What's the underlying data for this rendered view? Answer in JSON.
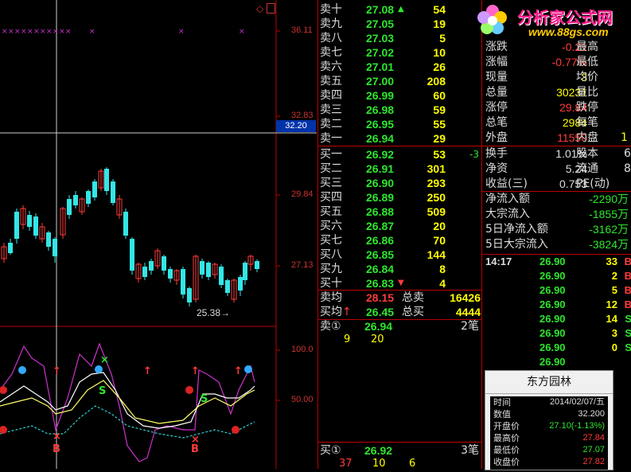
{
  "chart_axis": {
    "p1": "36.11",
    "p2": "32.83",
    "p3": "29.84",
    "p4": "27.13",
    "cursor": "32.20",
    "i1": "100.0",
    "i2": "50.00"
  },
  "annotation": "25.38",
  "sell_rows": [
    {
      "label": "卖十",
      "price": "27.08",
      "vol": "54",
      "arrow": "up"
    },
    {
      "label": "卖九",
      "price": "27.05",
      "vol": "19"
    },
    {
      "label": "卖八",
      "price": "27.03",
      "vol": "5"
    },
    {
      "label": "卖七",
      "price": "27.02",
      "vol": "10"
    },
    {
      "label": "卖六",
      "price": "27.01",
      "vol": "26"
    },
    {
      "label": "卖五",
      "price": "27.00",
      "vol": "208"
    },
    {
      "label": "卖四",
      "price": "26.99",
      "vol": "60"
    },
    {
      "label": "卖三",
      "price": "26.98",
      "vol": "59"
    },
    {
      "label": "卖二",
      "price": "26.95",
      "vol": "55"
    },
    {
      "label": "卖一",
      "price": "26.94",
      "vol": "29"
    }
  ],
  "buy_rows": [
    {
      "label": "买一",
      "price": "26.92",
      "vol": "53",
      "extra": "-3"
    },
    {
      "label": "买二",
      "price": "26.91",
      "vol": "301"
    },
    {
      "label": "买三",
      "price": "26.90",
      "vol": "293"
    },
    {
      "label": "买四",
      "price": "26.89",
      "vol": "250"
    },
    {
      "label": "买五",
      "price": "26.88",
      "vol": "509"
    },
    {
      "label": "买六",
      "price": "26.87",
      "vol": "20"
    },
    {
      "label": "买七",
      "price": "26.86",
      "vol": "70"
    },
    {
      "label": "买八",
      "price": "26.85",
      "vol": "144"
    },
    {
      "label": "买九",
      "price": "26.84",
      "vol": "8"
    },
    {
      "label": "买十",
      "price": "26.83",
      "vol": "4",
      "arrow": "down"
    }
  ],
  "avg": {
    "sell_label": "卖均",
    "sell_price": "28.15",
    "sell_total_label": "总卖",
    "sell_total": "16426",
    "buy_label": "买均",
    "buy_price": "26.45",
    "buy_total_label": "总买",
    "buy_total": "4444"
  },
  "queue": {
    "sell_label": "卖①",
    "sell_price": "26.94",
    "sell_count": "2笔",
    "sell_q": [
      "9",
      "20"
    ],
    "buy_label": "买①",
    "buy_price": "26.92",
    "buy_count": "3笔",
    "buy_q": [
      "37",
      "10",
      "6"
    ]
  },
  "stats": [
    {
      "k": "涨跌",
      "v": "-0.21",
      "k2": "最高"
    },
    {
      "k": "涨幅",
      "v": "-0.77%",
      "k2": "最低"
    },
    {
      "k": "现量",
      "v": "3",
      "k2": "均价"
    },
    {
      "k": "总量",
      "v": "30231",
      "k2": "量比"
    },
    {
      "k": "涨停",
      "v": "29.84",
      "k2": "跌停"
    },
    {
      "k": "总笔",
      "v": "2984",
      "k2": "每笔"
    },
    {
      "k": "外盘",
      "v": "11550",
      "k2": "内盘",
      "v2": "1"
    }
  ],
  "stats2": [
    {
      "k": "换手",
      "v": "1.01%",
      "k2": "股本",
      "v2": "6."
    },
    {
      "k": "净资",
      "v": "5.24",
      "k2": "流通",
      "v2": "8"
    },
    {
      "k": "收益(三)",
      "v": "0.753",
      "k2": "PE(动)"
    }
  ],
  "flows": [
    {
      "k": "净流入额",
      "v": "-2290万"
    },
    {
      "k": "大宗流入",
      "v": "-1855万"
    },
    {
      "k": "5日净流入额",
      "v": "-3162万"
    },
    {
      "k": "5日大宗流入",
      "v": "-3824万"
    }
  ],
  "ticks": [
    {
      "t": "14:17",
      "p": "26.90",
      "v": "33",
      "s": "B"
    },
    {
      "t": "",
      "p": "26.90",
      "v": "2",
      "s": "B"
    },
    {
      "t": "",
      "p": "26.90",
      "v": "5",
      "s": "B"
    },
    {
      "t": "",
      "p": "26.90",
      "v": "12",
      "s": "B"
    },
    {
      "t": "",
      "p": "26.90",
      "v": "14",
      "s": "S"
    },
    {
      "t": "",
      "p": "26.90",
      "v": "3",
      "s": "S"
    },
    {
      "t": "",
      "p": "26.90",
      "v": "0",
      "s": "S"
    },
    {
      "t": "",
      "p": "26.90",
      "v": "",
      "s": ""
    },
    {
      "t": "",
      "p": "",
      "v": "",
      "s": ""
    },
    {
      "t": "",
      "p": "",
      "v": "",
      "s": ""
    }
  ],
  "popup": {
    "title": "东方园林",
    "rows": [
      {
        "k": "时间",
        "v": "2014/02/07/五",
        "c": "#ddd"
      },
      {
        "k": "数值",
        "v": "32.200",
        "c": "#ddd"
      },
      {
        "k": "开盘价",
        "v": "27.10(-1.13%)",
        "c": "#2ee52e"
      },
      {
        "k": "最高价",
        "v": "27.84",
        "c": "#ff3b3b"
      },
      {
        "k": "最低价",
        "v": "27.07",
        "c": "#2ee52e"
      },
      {
        "k": "收盘价",
        "v": "27.82",
        "c": "#ff3b3b"
      }
    ]
  },
  "logo": {
    "text": "分析家公式网",
    "url": "www.88gs.com"
  },
  "colors": {
    "up": "#ff3b3b",
    "down": "#2ee52e",
    "candle": "#33e6e6",
    "volume": "#ffff00",
    "grid": "#b00000"
  }
}
